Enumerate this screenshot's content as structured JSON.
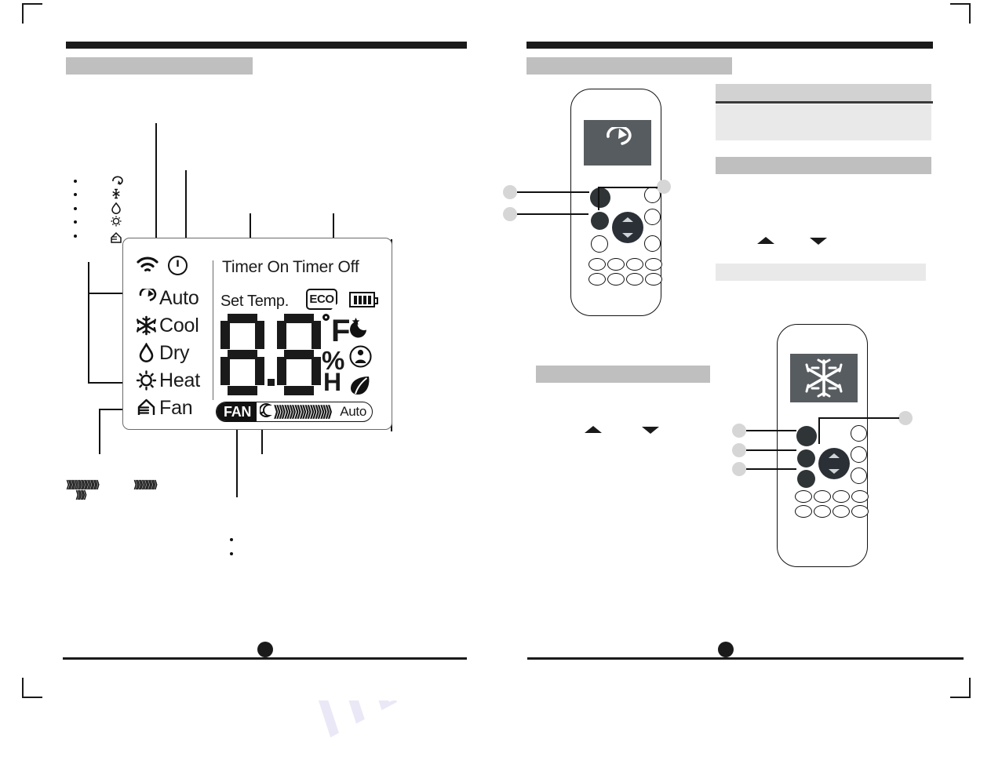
{
  "document": {
    "type": "appliance-manual-spread",
    "page_left": {
      "section_band_color": "#bfbfbf",
      "top_rule_color": "#1a1a1a",
      "page_marker": "●"
    },
    "page_right": {
      "section_band_color": "#bfbfbf",
      "note_box_color": "#e9e9e9",
      "page_marker": "●"
    }
  },
  "lcd": {
    "status_icons": [
      {
        "name": "wifi-icon",
        "label": "WiFi"
      },
      {
        "name": "power-icon",
        "label": "Power"
      }
    ],
    "timer_on": "Timer On",
    "timer_off": "Timer Off",
    "set_temp_label": "Set Temp.",
    "eco_badge": "ECO",
    "battery": {
      "name": "battery-icon",
      "bars": 4
    },
    "modes": [
      {
        "glyph": "auto-cycle-icon",
        "label": "Auto"
      },
      {
        "glyph": "snowflake-icon",
        "label": "Cool"
      },
      {
        "glyph": "droplet-icon",
        "label": "Dry"
      },
      {
        "glyph": "sun-icon",
        "label": "Heat"
      },
      {
        "glyph": "fan-house-icon",
        "label": "Fan"
      }
    ],
    "temperature_display": {
      "digits": "88",
      "decimal_point": ".",
      "unit": "°F",
      "percent": "%",
      "hours": "H"
    },
    "feature_icons": [
      {
        "name": "sleep-moon-star-icon",
        "label": "Sleep"
      },
      {
        "name": "follow-me-person-icon",
        "label": "Follow Me"
      },
      {
        "name": "eco-leaf-icon",
        "label": "Eco"
      }
    ],
    "fan_bar": {
      "tag": "FAN",
      "quiet_icon": "quiet-mode-icon",
      "auto": "Auto",
      "chevron_count": 11
    }
  },
  "left_legend": {
    "bullets": [
      "•",
      "•",
      "•",
      "•",
      "•"
    ],
    "mini_icons": [
      "auto-cycle-icon",
      "snowflake-icon",
      "droplet-icon",
      "sun-icon",
      "fan-house-icon"
    ],
    "arrow_runs": [
      "⟫⟫⟫⟫⟫⟫⟫⟫⟫⟫",
      "⟫⟫⟫",
      "⟫⟫⟫⟫⟫⟫⟫"
    ],
    "lower_bullets": [
      "•",
      "•"
    ]
  },
  "remote_top": {
    "screen_icon": "auto-cycle-icon",
    "callouts": [
      "●",
      "●",
      "●"
    ],
    "dpad": {
      "up": "▲",
      "down": "▼"
    }
  },
  "remote_bottom": {
    "screen_icon": "snowflake-icon",
    "callouts": [
      "●",
      "●",
      "●",
      "●"
    ],
    "dpad": {
      "up": "▲",
      "down": "▼"
    }
  },
  "right_controls": {
    "arrow_up": "▲",
    "arrow_down": "▼"
  },
  "watermark": "manualshive.com"
}
